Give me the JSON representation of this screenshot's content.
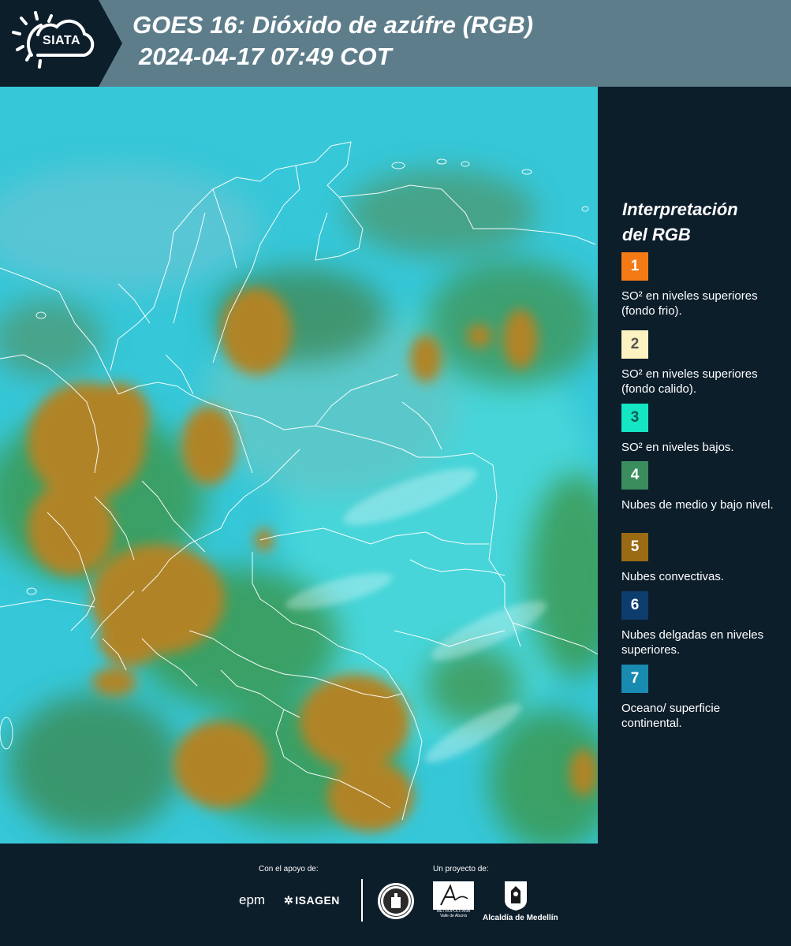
{
  "header": {
    "logo_text": "SIATA",
    "title_line_1": "GOES 16: Dióxido de azúfre (RGB)",
    "title_line_2": "2024-04-17 07:49 COT"
  },
  "legend": {
    "title_line_1": "Interpretación",
    "title_line_2": "del RGB",
    "items": [
      {
        "number": "1",
        "label": "SO² en niveles superiores (fondo frio).",
        "color": "#f47a16",
        "text_color": "#ffffff"
      },
      {
        "number": "2",
        "label": "SO² en niveles superiores (fondo calido).",
        "color": "#fdf3c1",
        "text_color": "#555555"
      },
      {
        "number": "3",
        "label": "SO² en niveles bajos.",
        "color": "#14e6c4",
        "text_color": "#0d5b50"
      },
      {
        "number": "4",
        "label": "Nubes de medio y bajo nivel.",
        "color": "#3a8d5d",
        "text_color": "#ffffff"
      },
      {
        "number": "5",
        "label": "Nubes convectivas.",
        "color": "#9b6b13",
        "text_color": "#ffffff"
      },
      {
        "number": "6",
        "label": "Nubes delgadas en niveles superiores.",
        "color": "#0d3d6d",
        "text_color": "#ffffff"
      },
      {
        "number": "7",
        "label": "Oceano/ superficie continental.",
        "color": "#1a8bb0",
        "text_color": "#ffffff"
      }
    ]
  },
  "footer": {
    "support_label": "Con el apoyo de:",
    "project_label": "Un proyecto de:",
    "epm_logo": "epm",
    "isagen_logo": "ISAGEN",
    "area_logo_lines": [
      "METROPOLITANA",
      "Valle de Aburrá"
    ],
    "medellin_logo": "Alcaldía de Medellín"
  },
  "map_colors": {
    "ocean": "#36c7d8",
    "land_cyan": "#3fd4d8",
    "green_cloud": "#3a9a52",
    "convective": "#b08425",
    "border": "#ffffff"
  }
}
